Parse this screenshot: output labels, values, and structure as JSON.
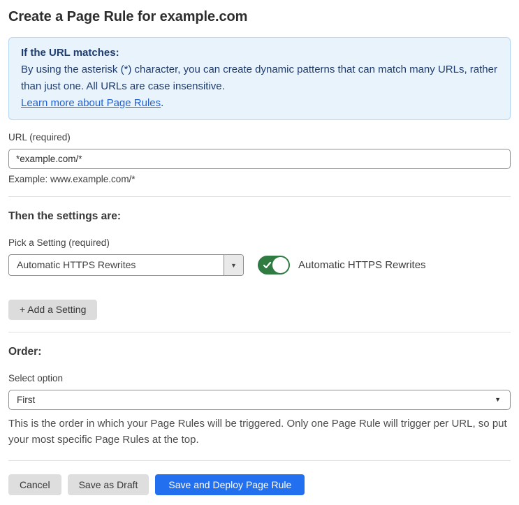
{
  "page": {
    "title": "Create a Page Rule for example.com"
  },
  "info_box": {
    "heading": "If the URL matches:",
    "body": "By using the asterisk (*) character, you can create dynamic patterns that can match many URLs, rather than just one. All URLs are case insensitive.",
    "link_label": "Learn more about Page Rules",
    "link_suffix": "."
  },
  "url_field": {
    "label": "URL (required)",
    "value": "*example.com/*",
    "example": "Example: www.example.com/*"
  },
  "settings_section": {
    "heading": "Then the settings are:",
    "picker_label": "Pick a Setting (required)",
    "picker_value": "Automatic HTTPS Rewrites",
    "toggle_state": "on",
    "toggle_label": "Automatic HTTPS Rewrites",
    "add_setting_label": "+ Add a Setting"
  },
  "order_section": {
    "heading": "Order:",
    "select_label": "Select option",
    "select_value": "First",
    "help_text": "This is the order in which your Page Rules will be triggered. Only one Page Rule will trigger per URL, so put your most specific Page Rules at the top."
  },
  "footer": {
    "cancel_label": "Cancel",
    "save_draft_label": "Save as Draft",
    "save_deploy_label": "Save and Deploy Page Rule"
  },
  "icons": {
    "caret_down": "▼"
  },
  "colors": {
    "primary_button": "#2270f0",
    "toggle_on_green": "#2f7b42",
    "info_box_bg": "#e9f3fc",
    "info_box_border": "#b3d6f5",
    "info_box_text": "#1e3c6e",
    "link_blue": "#2161d2",
    "gray_button_bg": "#dedede",
    "input_border": "#8e8e8e",
    "divider": "#dedede"
  }
}
